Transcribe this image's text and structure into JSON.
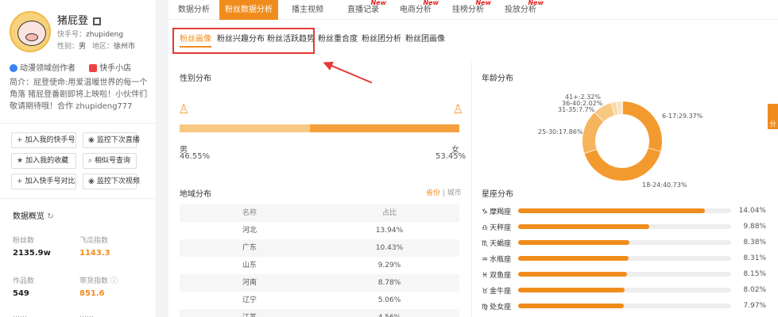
{
  "profile": {
    "name": "猪屁登",
    "kuaishou_label": "快手号：",
    "kuaishou_id": "zhupideng",
    "gender_label": "性别：",
    "gender_value": "男",
    "region_label": "地区：",
    "region_value": "徐州市",
    "tag_creator": "动漫领域创作者",
    "tag_shop": "快手小店",
    "bio": "简介：屁登使命:用爱温暖世界的每一个角落 猪屁登番剧即将上映啦！小伙伴们敬请期待哦！合作 zhupideng777"
  },
  "actions": {
    "add_kuaishou": "加入我的快手号",
    "monitor_live": "监控下次直播",
    "add_favorite": "加入我的收藏",
    "similar_search": "相似号查询",
    "add_compare": "加入快手号对比",
    "monitor_video": "监控下次视频"
  },
  "overview": {
    "title": "数据概览",
    "fans_label": "粉丝数",
    "fans_value": "2135.9w",
    "feigua_label": "飞瓜指数",
    "feigua_value": "1143.3",
    "works_label": "作品数",
    "works_value": "549",
    "goods_label": "带货指数",
    "goods_value": "851.6",
    "bottom_left": "……",
    "bottom_right": "……"
  },
  "tabs": [
    {
      "label": "数据分析"
    },
    {
      "label": "粉丝数据分析"
    },
    {
      "label": "播主视频"
    },
    {
      "label": "直播记录",
      "badge": "New"
    },
    {
      "label": "电商分析",
      "badge": "New"
    },
    {
      "label": "挂榜分析",
      "badge": "New"
    },
    {
      "label": "投放分析",
      "badge": "New"
    }
  ],
  "subtabs": [
    "粉丝画像",
    "粉丝兴趣分布",
    "粉丝活跃趋势",
    "粉丝重合度",
    "粉丝团分析",
    "粉丝团画像"
  ],
  "gender": {
    "title": "性别分布",
    "male_label": "男",
    "male_pct": "46.55%",
    "female_label": "女",
    "female_pct": "53.45%",
    "male_value": 46.55
  },
  "region": {
    "title": "地域分布",
    "toggle_province": "省份",
    "toggle_sep": " | ",
    "toggle_city": "城市",
    "col_name": "名称",
    "col_pct": "占比",
    "rows": [
      {
        "name": "河北",
        "pct": "13.94%"
      },
      {
        "name": "广东",
        "pct": "10.43%"
      },
      {
        "name": "山东",
        "pct": "9.29%"
      },
      {
        "name": "河南",
        "pct": "8.78%"
      },
      {
        "name": "辽宁",
        "pct": "5.06%"
      },
      {
        "name": "江苏",
        "pct": "4.56%"
      }
    ]
  },
  "age": {
    "title": "年龄分布",
    "labels": [
      "41+:2.32%",
      "36-40:2.02%",
      "31-35:7.7%",
      "6-17:29.37%",
      "25-30:17.86%",
      "18-24:40.73%"
    ]
  },
  "chart_data": {
    "type": "pie",
    "title": "年龄分布",
    "categories": [
      "6-17",
      "18-24",
      "25-30",
      "31-35",
      "36-40",
      "41+"
    ],
    "values": [
      29.37,
      40.73,
      17.86,
      7.7,
      2.02,
      2.32
    ],
    "colors": [
      "#f39a2e",
      "#f39a2e",
      "#f6b45c",
      "#f8c883",
      "#f9d7a8",
      "#fbe3c2"
    ]
  },
  "zodiac": {
    "title": "星座分布",
    "items": [
      {
        "icon": "♑",
        "name": "摩羯座",
        "pct": "14.04%",
        "value": 14.04
      },
      {
        "icon": "♎",
        "name": "天秤座",
        "pct": "9.88%",
        "value": 9.88
      },
      {
        "icon": "♏",
        "name": "天蝎座",
        "pct": "8.38%",
        "value": 8.38
      },
      {
        "icon": "♒",
        "name": "水瓶座",
        "pct": "8.31%",
        "value": 8.31
      },
      {
        "icon": "♓",
        "name": "双鱼座",
        "pct": "8.15%",
        "value": 8.15
      },
      {
        "icon": "♉",
        "name": "金牛座",
        "pct": "8.02%",
        "value": 8.02
      },
      {
        "icon": "♍",
        "name": "处女座",
        "pct": "7.97%",
        "value": 7.97
      }
    ]
  },
  "side_tab": "分享"
}
